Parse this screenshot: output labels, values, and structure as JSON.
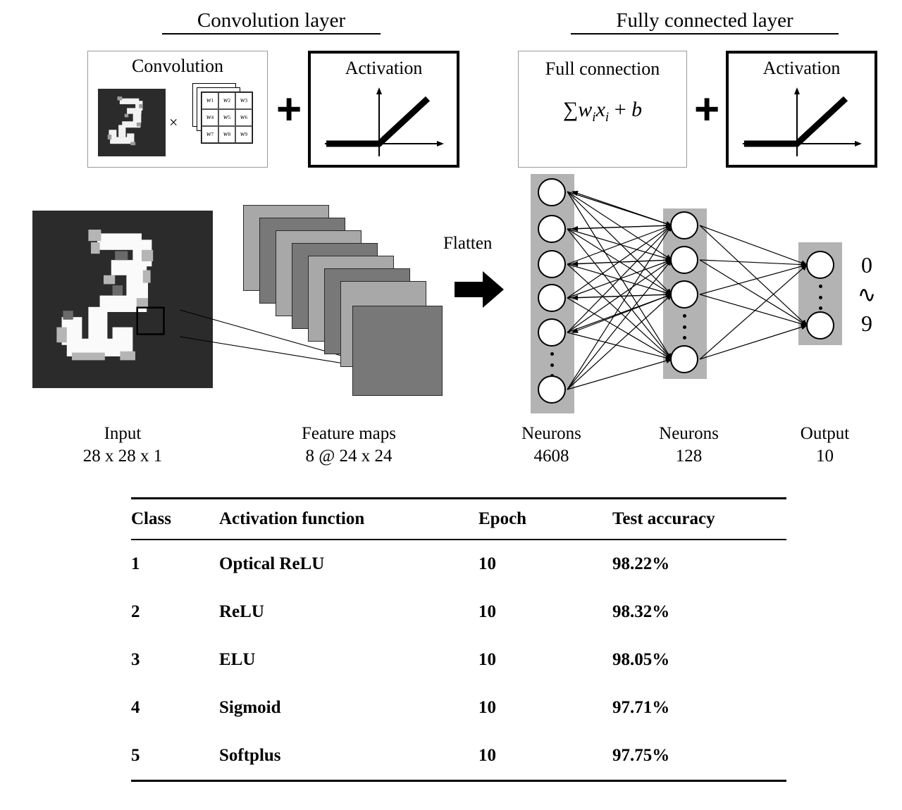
{
  "figure": {
    "sections": [
      {
        "title": "Convolution layer"
      },
      {
        "title": "Fully connected layer"
      }
    ],
    "modules": {
      "convolution": {
        "title": "Convolution",
        "operator": "×"
      },
      "activation_conv": {
        "title": "Activation"
      },
      "full_connection": {
        "title": "Full connection",
        "formula_sum": "∑",
        "formula_w": "w",
        "formula_wi": "i",
        "formula_x": "x",
        "formula_xi": "i",
        "formula_plus": "+",
        "formula_b": "b",
        "formula_text": "∑wᵢxᵢ + b"
      },
      "activation_fc": {
        "title": "Activation"
      }
    },
    "plus_operators": [
      "+",
      "+"
    ],
    "kernel": {
      "weights": [
        "w1",
        "w2",
        "w3",
        "w4",
        "w5",
        "w6",
        "w7",
        "w8",
        "w9"
      ],
      "labels": [
        "w",
        "w",
        "w",
        "w",
        "w",
        "w",
        "w",
        "w",
        "w"
      ],
      "subscripts": [
        "1",
        "2",
        "3",
        "4",
        "5",
        "6",
        "7",
        "8",
        "9"
      ],
      "stack_count": 3,
      "rows": 3,
      "cols": 3
    },
    "flatten_label": "Flatten",
    "feature_maps": {
      "count": 8
    },
    "network": {
      "input_layer": {
        "visible_neurons": 6,
        "dots_after_index": 5
      },
      "hidden_layer": {
        "visible_neurons": 4,
        "dots_after_index": 3
      },
      "output_layer": {
        "visible_neurons": 2,
        "dots_after_index": 1
      },
      "output_digits": [
        "0",
        "∿",
        "9"
      ]
    },
    "captions": [
      {
        "name": "Input",
        "detail": "28 x 28 x 1"
      },
      {
        "name": "Feature maps",
        "detail": "8 @ 24 x 24"
      },
      {
        "name": "Neurons",
        "detail": "4608"
      },
      {
        "name": "Neurons",
        "detail": "128"
      },
      {
        "name": "Output",
        "detail": "10"
      }
    ]
  },
  "table": {
    "columns": [
      "Class",
      "Activation function",
      "Epoch",
      "Test accuracy"
    ],
    "rows": [
      {
        "class": "1",
        "activation": "Optical ReLU",
        "epoch": "10",
        "accuracy": "98.22%"
      },
      {
        "class": "2",
        "activation": "ReLU",
        "epoch": "10",
        "accuracy": "98.32%"
      },
      {
        "class": "3",
        "activation": "ELU",
        "epoch": "10",
        "accuracy": "98.05%"
      },
      {
        "class": "4",
        "activation": "Sigmoid",
        "epoch": "10",
        "accuracy": "97.71%"
      },
      {
        "class": "5",
        "activation": "Softplus",
        "epoch": "10",
        "accuracy": "97.75%"
      }
    ]
  },
  "colors": {
    "band_gray": "#b3b3b3",
    "fmap_light": "#a8a8a8",
    "fmap_dark": "#787878",
    "mnist_bg": "#2b2b2b",
    "ink": "#000000"
  }
}
